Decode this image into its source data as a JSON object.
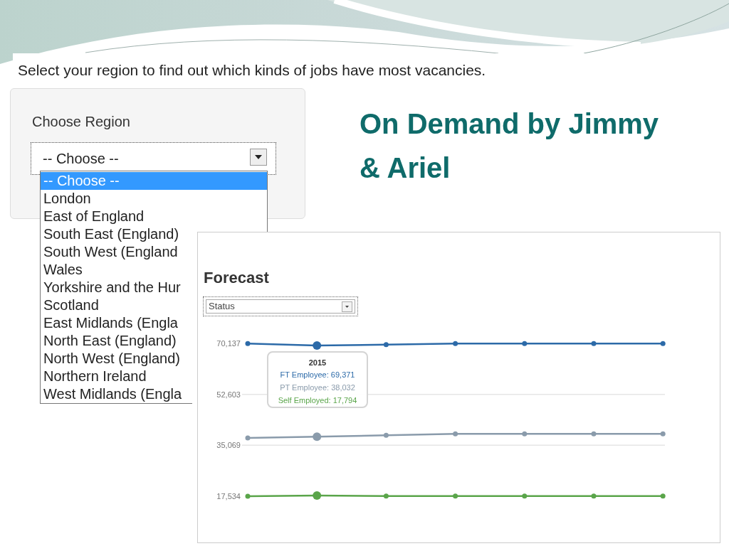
{
  "instruction": "Select your region to find out which kinds of jobs have most vacancies.",
  "title": "On Demand by Jimmy & Ariel",
  "region_panel": {
    "label": "Choose Region",
    "select_value": "-- Choose --",
    "options": [
      {
        "label": "-- Choose --",
        "selected": true
      },
      {
        "label": "London",
        "selected": false
      },
      {
        "label": "East of England",
        "selected": false
      },
      {
        "label": "South East (England)",
        "selected": false
      },
      {
        "label": "South West (England",
        "selected": false
      },
      {
        "label": "Wales",
        "selected": false
      },
      {
        "label": "Yorkshire and the Hur",
        "selected": false
      },
      {
        "label": "Scotland",
        "selected": false
      },
      {
        "label": "East Midlands (Engla",
        "selected": false
      },
      {
        "label": "North East (England)",
        "selected": false
      },
      {
        "label": "North West (England)",
        "selected": false
      },
      {
        "label": "Northern Ireland",
        "selected": false
      },
      {
        "label": "West Midlands (Engla",
        "selected": false
      }
    ]
  },
  "forecast": {
    "heading": "Forecast",
    "filter": {
      "value": "Status"
    },
    "chart_data": {
      "type": "line",
      "ylim": [
        17534,
        70137
      ],
      "ref_lines": [
        {
          "axis": "y",
          "value": 52603
        },
        {
          "axis": "y",
          "value": 35069
        }
      ],
      "yticks": [
        {
          "value": 70137,
          "label": "70,137"
        },
        {
          "value": 52603,
          "label": "52,603"
        },
        {
          "value": 35069,
          "label": "35,069"
        },
        {
          "value": 17534,
          "label": "17,534"
        }
      ],
      "series": [
        {
          "name": "FT Employee",
          "color": "#2c6aa8",
          "marker": "circle",
          "values": [
            70100,
            69400,
            69700,
            70100,
            70100,
            70100,
            70100
          ]
        },
        {
          "name": "PT Employee",
          "color": "#8a9bab",
          "marker": "circle",
          "values": [
            37600,
            38000,
            38500,
            39000,
            39000,
            39000,
            39000
          ]
        },
        {
          "name": "Self Employed",
          "color": "#5aa54a",
          "marker": "circle",
          "values": [
            17534,
            17800,
            17600,
            17600,
            17600,
            17600,
            17600
          ]
        }
      ]
    },
    "tooltip": {
      "title": "2015",
      "rows": [
        {
          "value": ": 69,371"
        },
        {
          "value": ": 38,032"
        },
        {
          "value": ": 17,794"
        }
      ]
    }
  }
}
